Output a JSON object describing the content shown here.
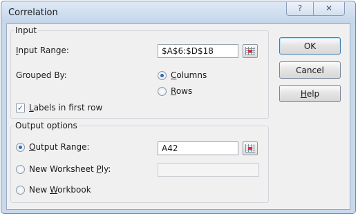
{
  "window": {
    "title": "Correlation"
  },
  "titlebar": {
    "help_glyph": "?",
    "close_glyph": "✕"
  },
  "input_group": {
    "legend": "Input",
    "input_range_label_pre": "",
    "input_range_label_key": "I",
    "input_range_label_post": "nput Range:",
    "input_range_value": "$A$6:$D$18",
    "grouped_by_label": "Grouped By:",
    "columns_label_pre": "",
    "columns_label_key": "C",
    "columns_label_post": "olumns",
    "columns_selected": true,
    "rows_label_pre": "",
    "rows_label_key": "R",
    "rows_label_post": "ows",
    "rows_selected": false,
    "labels_label_pre": "",
    "labels_label_key": "L",
    "labels_label_post": "abels in first row",
    "labels_checked": true,
    "checkmark_glyph": "✓"
  },
  "output_group": {
    "legend": "Output options",
    "output_range_label_pre": "",
    "output_range_label_key": "O",
    "output_range_label_post": "utput Range:",
    "output_range_selected": true,
    "output_range_value": "A42",
    "new_ply_label_pre": "New Worksheet ",
    "new_ply_label_key": "P",
    "new_ply_label_post": "ly:",
    "new_ply_value": "",
    "new_workbook_label_pre": "New ",
    "new_workbook_label_key": "W",
    "new_workbook_label_post": "orkbook"
  },
  "buttons": {
    "ok": "OK",
    "cancel": "Cancel",
    "help_pre": "",
    "help_key": "H",
    "help_post": "elp"
  },
  "icons": {
    "range_selector": "range-selector-icon"
  }
}
